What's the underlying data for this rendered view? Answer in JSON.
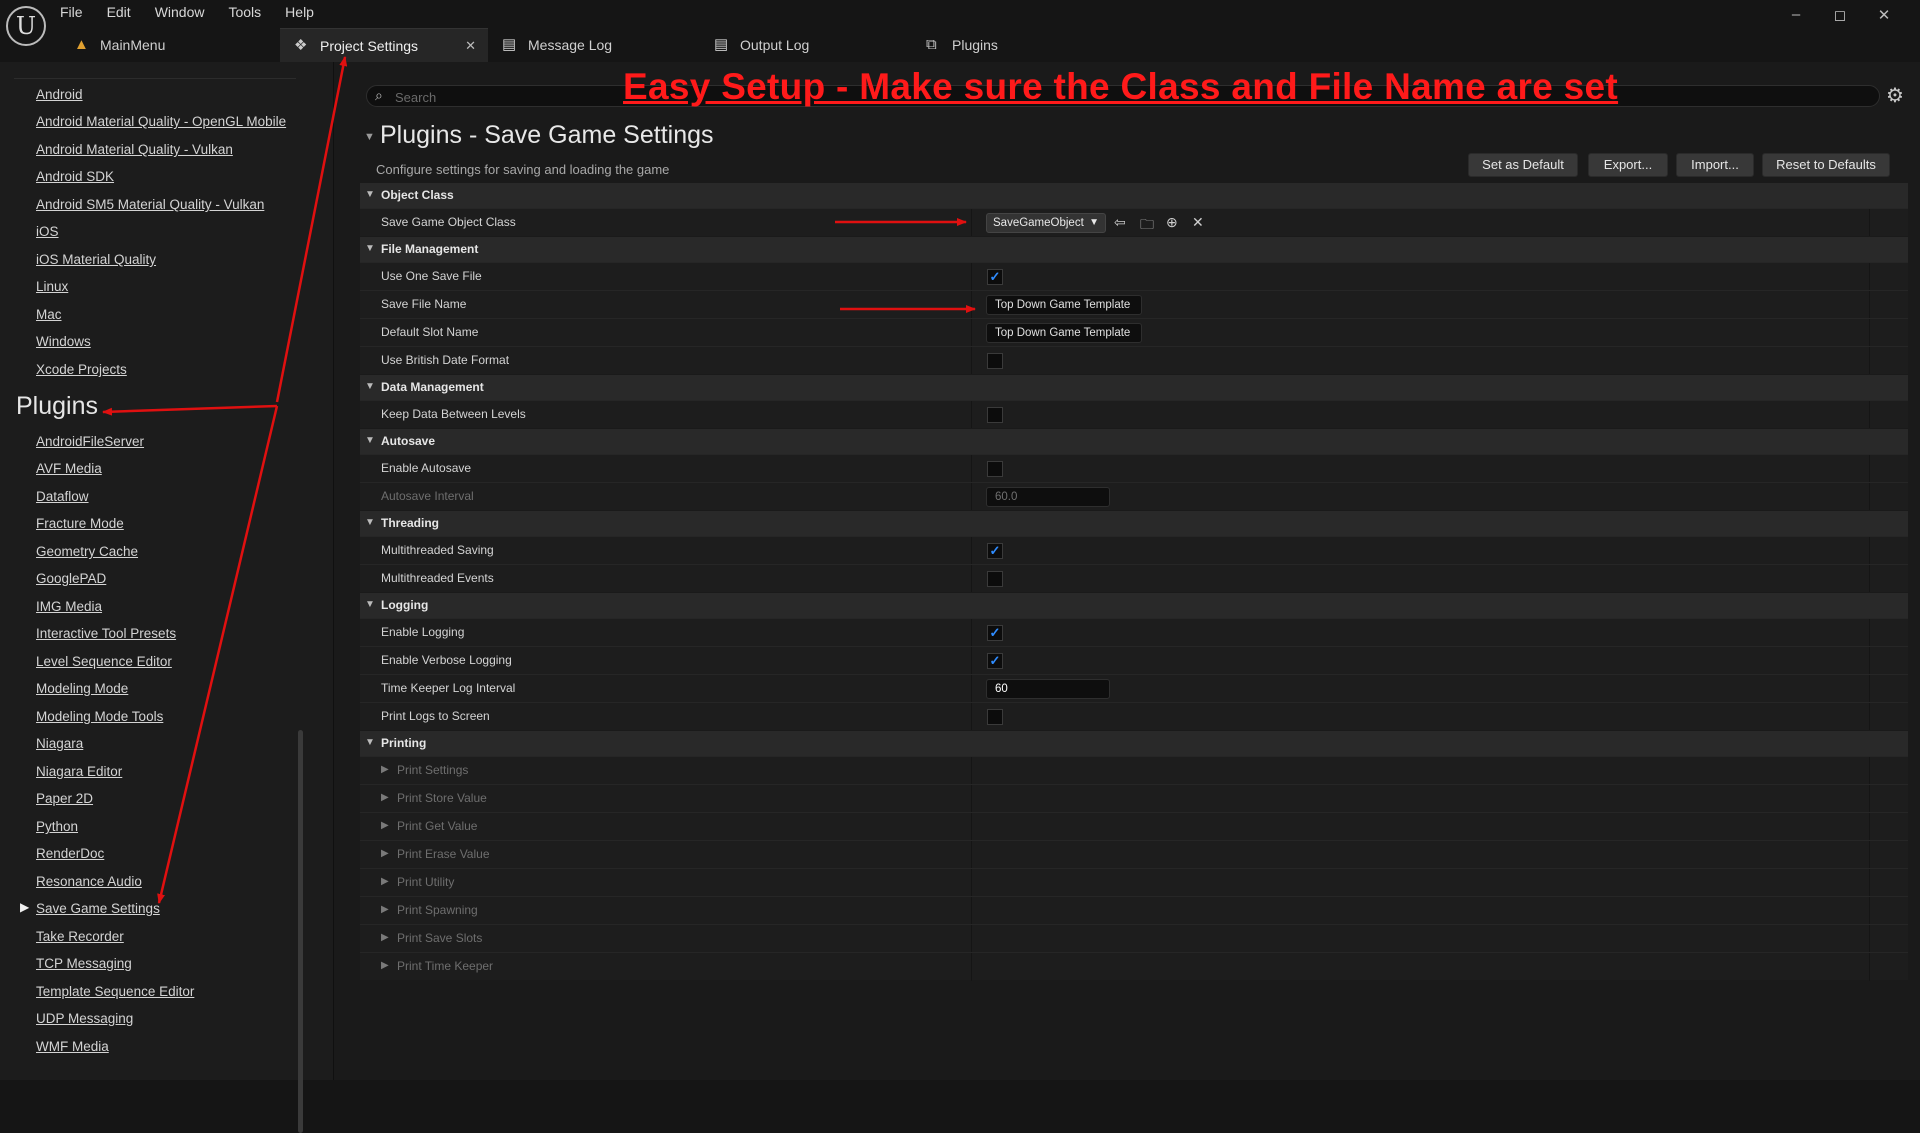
{
  "menu": [
    "File",
    "Edit",
    "Window",
    "Tools",
    "Help"
  ],
  "window_controls": {
    "minimize": "–",
    "restore": "◻",
    "close": "✕"
  },
  "tabs": [
    {
      "label": "MainMenu",
      "icon": "level-icon"
    },
    {
      "label": "Project Settings",
      "icon": "project-settings-icon",
      "active": true
    },
    {
      "label": "Message Log",
      "icon": "log-icon"
    },
    {
      "label": "Output Log",
      "icon": "output-log-icon"
    },
    {
      "label": "Plugins",
      "icon": "plugins-icon"
    }
  ],
  "left": {
    "platform_items": [
      "Android",
      "Android Material Quality - OpenGL Mobile",
      "Android Material Quality - Vulkan",
      "Android SDK",
      "Android SM5 Material Quality - Vulkan",
      "iOS",
      "iOS Material Quality",
      "Linux",
      "Mac",
      "Windows",
      "Xcode Projects"
    ],
    "plugins_heading": "Plugins",
    "plugin_items": [
      "AndroidFileServer",
      "AVF Media",
      "Dataflow",
      "Fracture Mode",
      "Geometry Cache",
      "GooglePAD",
      "IMG Media",
      "Interactive Tool Presets",
      "Level Sequence Editor",
      "Modeling Mode",
      "Modeling Mode Tools",
      "Niagara",
      "Niagara Editor",
      "Paper 2D",
      "Python",
      "RenderDoc",
      "Resonance Audio",
      "Save Game Settings",
      "Take Recorder",
      "TCP Messaging",
      "Template Sequence Editor",
      "UDP Messaging",
      "WMF Media"
    ],
    "selected": "Save Game Settings"
  },
  "search": {
    "placeholder": "Search"
  },
  "annotation": "Easy Setup - Make sure the Class and File Name are set",
  "section": {
    "title": "Plugins - Save Game Settings",
    "description": "Configure settings for saving and loading the game"
  },
  "buttons": {
    "set_default": "Set as Default",
    "export": "Export...",
    "import": "Import...",
    "reset": "Reset to Defaults"
  },
  "details": {
    "object_class": {
      "label": "Object Class",
      "save_game_object_class": "Save Game Object Class",
      "class_value": "SaveGameObject"
    },
    "file_management": {
      "label": "File Management",
      "use_one_save_file": "Use One Save File",
      "use_one_save_file_value": true,
      "save_file_name": "Save File Name",
      "save_file_name_value": "Top Down Game Template",
      "default_slot_name": "Default Slot Name",
      "default_slot_name_value": "Top Down Game Template",
      "use_british_date_format": "Use British Date Format",
      "use_british_date_format_value": false
    },
    "data_management": {
      "label": "Data Management",
      "keep_data_between_levels": "Keep Data Between Levels",
      "keep_data_value": false
    },
    "autosave": {
      "label": "Autosave",
      "enable_autosave": "Enable Autosave",
      "enable_autosave_value": false,
      "autosave_interval": "Autosave Interval",
      "autosave_interval_value": "60.0"
    },
    "threading": {
      "label": "Threading",
      "multithreaded_saving": "Multithreaded Saving",
      "multithreaded_saving_value": true,
      "multithreaded_events": "Multithreaded Events",
      "multithreaded_events_value": false
    },
    "logging": {
      "label": "Logging",
      "enable_logging": "Enable Logging",
      "enable_logging_value": true,
      "enable_verbose_logging": "Enable Verbose Logging",
      "enable_verbose_logging_value": true,
      "time_keeper_log_interval": "Time Keeper Log Interval",
      "time_keeper_log_interval_value": "60",
      "print_logs_to_screen": "Print Logs to Screen",
      "print_logs_to_screen_value": false
    },
    "printing": {
      "label": "Printing",
      "items": [
        "Print Settings",
        "Print Store Value",
        "Print Get Value",
        "Print Erase Value",
        "Print Utility",
        "Print Spawning",
        "Print Save Slots",
        "Print Time Keeper"
      ]
    }
  },
  "colors": {
    "annotation": "#ff1a1a",
    "checkbox_check": "#2f8cff",
    "background": "#151515"
  }
}
